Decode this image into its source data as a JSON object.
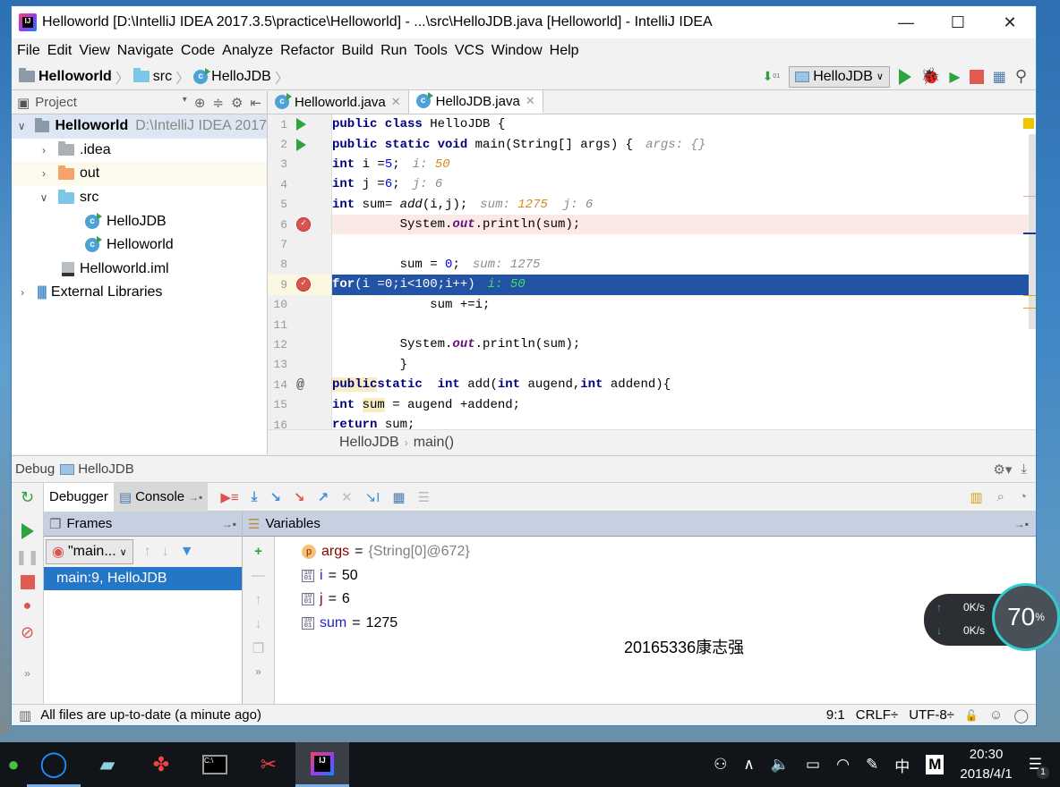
{
  "window": {
    "title": "Helloworld [D:\\IntelliJ IDEA 2017.3.5\\practice\\Helloworld] - ...\\src\\HelloJDB.java [Helloworld] - IntelliJ IDEA",
    "controls": {
      "minimize": "—",
      "maximize": "☐",
      "close": "✕"
    }
  },
  "menu": [
    "File",
    "Edit",
    "View",
    "Navigate",
    "Code",
    "Analyze",
    "Refactor",
    "Build",
    "Run",
    "Tools",
    "VCS",
    "Window",
    "Help"
  ],
  "navbar": {
    "crumbs": [
      "Helloworld",
      "src",
      "HelloJDB"
    ],
    "run_config": "HelloJDB"
  },
  "project": {
    "header": "Project",
    "tree": [
      {
        "label": "Helloworld",
        "extra": "D:\\IntelliJ IDEA 2017",
        "type": "module",
        "expanded": true,
        "depth": 0
      },
      {
        "label": ".idea",
        "type": "folder-grey",
        "expanded": false,
        "depth": 1
      },
      {
        "label": "out",
        "type": "folder-orange",
        "expanded": false,
        "depth": 1
      },
      {
        "label": "src",
        "type": "folder-blue",
        "expanded": true,
        "depth": 1
      },
      {
        "label": "HelloJDB",
        "type": "class",
        "depth": 2
      },
      {
        "label": "Helloworld",
        "type": "class",
        "depth": 2
      },
      {
        "label": "Helloworld.iml",
        "type": "iml",
        "depth": 1
      },
      {
        "label": "External Libraries",
        "type": "lib",
        "expanded": false,
        "depth": 0
      }
    ]
  },
  "editor": {
    "tabs": [
      {
        "label": "Helloworld.java",
        "active": false
      },
      {
        "label": "HelloJDB.java",
        "active": true
      }
    ],
    "lines": [
      {
        "n": "1",
        "text": "public class HelloJDB {"
      },
      {
        "n": "2",
        "text": "    public static void main(String[] args) {",
        "hint": "args: {}"
      },
      {
        "n": "3",
        "text": "        int i =5;",
        "hint_label": "i:",
        "hint_value": "50"
      },
      {
        "n": "4",
        "text": "        int j =6;",
        "hint": "j: 6"
      },
      {
        "n": "5",
        "text": "        int sum= add(i,j);",
        "hint_label": "sum:",
        "hint_value": "1275",
        "hint_extra": "j: 6"
      },
      {
        "n": "6",
        "text": "        System.out.println(sum);",
        "breakpoint": true
      },
      {
        "n": "7",
        "text": ""
      },
      {
        "n": "8",
        "text": "        sum = 0;",
        "hint": "sum: 1275"
      },
      {
        "n": "9",
        "text": "        for(i =0;i<100;i++)",
        "hint": "i: 50",
        "current": true
      },
      {
        "n": "10",
        "text": "            sum +=i;"
      },
      {
        "n": "11",
        "text": ""
      },
      {
        "n": "12",
        "text": "        System.out.println(sum);"
      },
      {
        "n": "13",
        "text": "        }"
      },
      {
        "n": "14",
        "text": "        public static  int add(int augend,int addend){"
      },
      {
        "n": "15",
        "text": "        int sum = augend +addend;"
      },
      {
        "n": "16",
        "text": "        return sum;"
      }
    ],
    "breadcrumb": [
      "HelloJDB",
      "main()"
    ]
  },
  "debug": {
    "title": "Debug",
    "config": "HelloJDB",
    "tabs": [
      "Debugger",
      "Console"
    ],
    "frames_header": "Frames",
    "variables_header": "Variables",
    "thread": "\"main...",
    "frames": [
      "main:9, HelloJDB"
    ],
    "variables": [
      {
        "badge": "p",
        "name": "args",
        "value": "{String[0]@672}"
      },
      {
        "badge": "int",
        "name": "i",
        "value": "50"
      },
      {
        "badge": "int",
        "name": "j",
        "value": "6"
      },
      {
        "badge": "int",
        "name": "sum",
        "value": "1275"
      }
    ],
    "watermark": "20165336康志强"
  },
  "status": {
    "message": "All files are up-to-date (a minute ago)",
    "position": "9:1",
    "line_sep": "CRLF÷",
    "encoding": "UTF-8÷"
  },
  "netmonitor": {
    "up": "0K/s",
    "down": "0K/s",
    "percent": "70",
    "percent_sign": "%"
  },
  "taskbar": {
    "time": "20:30",
    "date": "2018/4/1",
    "ime": "中",
    "notifications": "1"
  }
}
